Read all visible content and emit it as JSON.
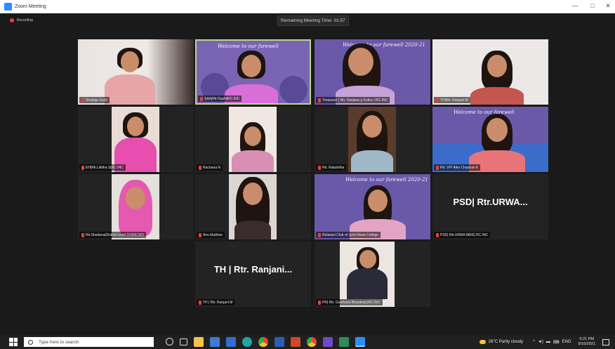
{
  "window": {
    "title": "Zoom Meeting",
    "minimize": "—",
    "maximize": "□",
    "close": "✕"
  },
  "meeting": {
    "recording_label": "Recording",
    "timer": "Remaining Meeting Time: 01:57",
    "banner_texts": {
      "b1": "Welcome to our farewell",
      "b2": "Welcome to our farewell 2020-21",
      "b3": "Welcome to our farewell",
      "b4": "Welcome to our farewell 2020-21"
    },
    "participants": [
      {
        "name": "Shailaja Joshi",
        "video": true
      },
      {
        "name": "SAA|Rtr.Rashi|RC.INC",
        "video": true,
        "active": true
      },
      {
        "name": "Treasurer | Rtr. Sanjana g Kottur | RC.INC",
        "video": true
      },
      {
        "name": "TH|Rtr. Ranjani M",
        "video": true
      },
      {
        "name": "EH|Rtr.Likitha S|RC.INC",
        "video": true
      },
      {
        "name": "Rachana N",
        "video": true
      },
      {
        "name": "Rtr. Rakshitha",
        "video": true
      },
      {
        "name": "Rtr. VP/ Alka Chauhan K",
        "video": true
      },
      {
        "name": "Rtr.Shaliana|District Level 3190|CSD)",
        "video": true
      },
      {
        "name": "Anu Mathew",
        "video": true
      },
      {
        "name": "Rotaract Club of Jyoti Nivas College",
        "video": true
      },
      {
        "name": "PSD| Rtr.URWA ABID| RC.INC",
        "video": false,
        "display": "PSD| Rtr.URWA..."
      },
      {
        "name": "TH | Rtr. Ranjani M",
        "video": false,
        "display": "TH | Rtr. Ranjani..."
      },
      {
        "name": "PR| Rtr. Gouthami Bhardwaj |RC.INC",
        "video": true
      }
    ]
  },
  "taskbar": {
    "search_placeholder": "Type here to search",
    "weather": "28°C  Partly cloudy",
    "lang": "ENG",
    "time": "5:21 PM",
    "date": "9/16/2021",
    "icons": [
      "task-view-icon",
      "file-explorer-icon",
      "store-icon",
      "mail-icon",
      "edge-icon",
      "chrome-icon",
      "word-icon",
      "powerpoint-icon",
      "chrome-icon",
      "photos-icon",
      "zoom-icon"
    ]
  }
}
